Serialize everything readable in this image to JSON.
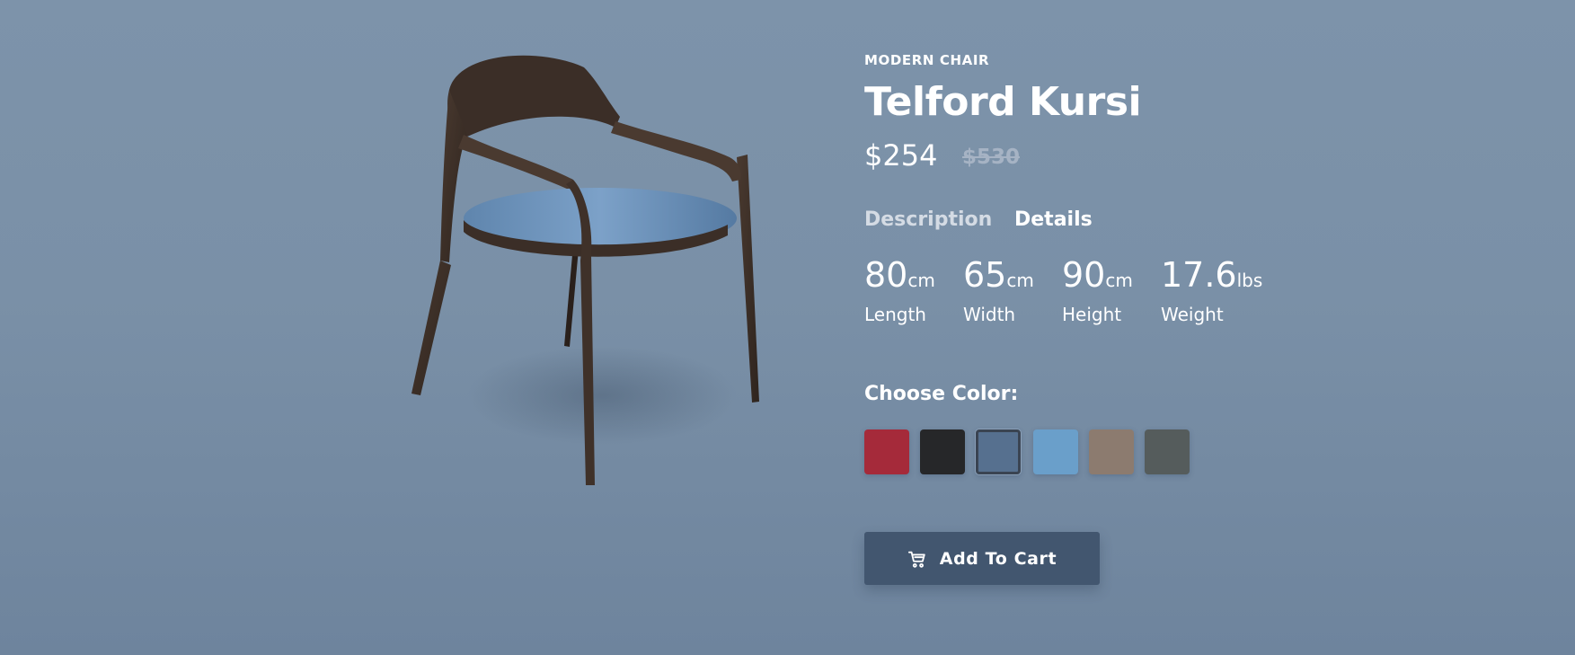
{
  "product": {
    "category": "MODERN CHAIR",
    "name": "Telford Kursi",
    "price": "$254",
    "old_price": "$530"
  },
  "tabs": [
    {
      "label": "Description"
    },
    {
      "label": "Details"
    }
  ],
  "specs": [
    {
      "value": "80",
      "unit": "cm",
      "label": "Length"
    },
    {
      "value": "65",
      "unit": "cm",
      "label": "Width"
    },
    {
      "value": "90",
      "unit": "cm",
      "label": "Height"
    },
    {
      "value": "17.6",
      "unit": "lbs",
      "label": "Weight"
    }
  ],
  "colors": {
    "heading": "Choose Color:",
    "swatches": [
      {
        "name": "red",
        "color": "#a52a3a"
      },
      {
        "name": "black",
        "color": "#262729"
      },
      {
        "name": "blue-velvet",
        "color": "#56708f",
        "selected": true
      },
      {
        "name": "light-blue",
        "color": "#6a9fca"
      },
      {
        "name": "taupe",
        "color": "#8c7b6f"
      },
      {
        "name": "gray",
        "color": "#555c5c"
      }
    ]
  },
  "cart_button": {
    "label": "Add To Cart",
    "icon": "cart-icon"
  },
  "theme": {
    "accent": "#42566f",
    "background": "#7d93aa"
  }
}
